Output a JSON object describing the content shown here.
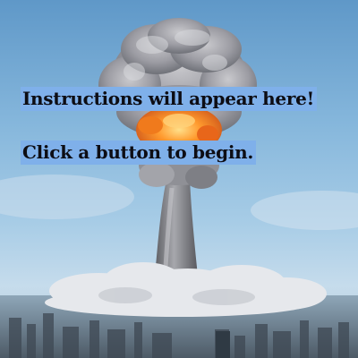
{
  "instructions": {
    "line1": "Instructions will appear here!",
    "line2": "Click a button to begin."
  },
  "colors": {
    "text_highlight": "#7fb0ea",
    "text": "#0d0d14",
    "sky_top": "#5f98c8",
    "fire": "#f07a1c"
  },
  "background": {
    "icon": "mushroom-cloud-image"
  }
}
